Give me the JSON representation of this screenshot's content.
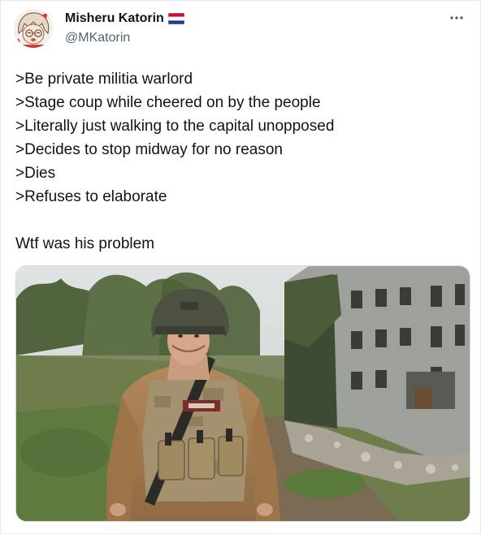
{
  "author": {
    "display_name": "Misheru Katorin",
    "handle": "@MKatorin",
    "flag_icon": "netherlands-flag-icon",
    "avatar_icon": "anime-avatar"
  },
  "menu": {
    "more_icon": "more-options-icon",
    "glyph": "···"
  },
  "tweet": {
    "lines": [
      ">Be private militia warlord",
      ">Stage coup while cheered on by the people",
      ">Literally just walking to the capital unopposed",
      ">Decides to stop midway for no reason",
      ">Dies",
      ">Refuses to elaborate"
    ],
    "closing": "Wtf was his problem"
  },
  "media": {
    "type": "photo"
  },
  "colors": {
    "text": "#0f1419",
    "secondary": "#536471",
    "border": "#cfd9de"
  }
}
